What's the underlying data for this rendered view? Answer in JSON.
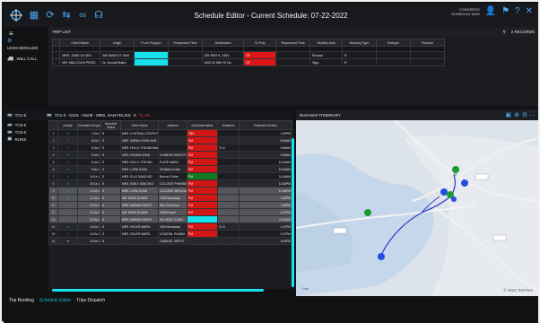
{
  "app": {
    "title": "Schedule Editor - Current Schedule: 07-22-2022",
    "user_line1": "CONGRESS",
    "user_line2": "SCHEDULE ADM"
  },
  "topbar_icons": [
    "grid-icon",
    "refresh-icon",
    "swap-icon",
    "link-icon",
    "headset-icon"
  ],
  "topbar_right_icons": [
    "user-icon",
    "filter-icon",
    "help-icon",
    "menu-icon"
  ],
  "sidebar": {
    "unscheduled_label": "UNSCHEDULED",
    "will_call_label": "WILL CALL"
  },
  "trip_list": {
    "header_label": "TRIP LIST",
    "records_label": "2 RECORDS",
    "columns": [
      "Client Name",
      "Origin",
      "From Polygon",
      "Requested Time",
      "Destination",
      "To Poly",
      "Requested Time",
      "Mobility Aids",
      "Booking Type",
      "Subtype",
      "Purpose"
    ],
    "rows": [
      {
        "client": "MRS. JANE OLSEN",
        "origin": "360 MAIN ST SAN",
        "from_poly": "",
        "req_time": "",
        "dest": "DR SMITH, 1555",
        "to_poly": "SF",
        "req_time2": "",
        "mobility": "Browse",
        "booking": "R",
        "subtype": "",
        "purpose": ""
      },
      {
        "client": "MR. MALCOLM PRICE",
        "origin": "Dr. Donald Baird",
        "from_poly": "",
        "req_time": "",
        "dest": "6302 B 28th St Oa",
        "to_poly": "SF",
        "req_time2": "",
        "mobility": "Sign",
        "booking": "R",
        "subtype": "",
        "purpose": ""
      }
    ]
  },
  "midbar": {
    "run_label": "TC1-5",
    "run_detail": "TC1-5 - D101 - M108 - MRS. SAN FELIKS",
    "marker": "X",
    "time_red": "TL-33"
  },
  "runs_sidebar": [
    {
      "label": "TC5-5",
      "icon": "bus-icon"
    },
    {
      "label": "TC5-5",
      "icon": "bus-icon"
    },
    {
      "label": "RUNS",
      "icon": "runs-icon"
    }
  ],
  "schedule": {
    "columns": [
      "",
      "Activity",
      "Estimated Depar",
      "Schedule Status",
      "Client Name",
      "Address",
      "Early/Alternative",
      "Violations",
      "Estimated Deliver"
    ],
    "rows": [
      {
        "n": "1",
        "act": "g",
        "dep": "7:0x:1",
        "status": "S",
        "client": "MRS. CYNTHIA LOCATE PHARMACY",
        "addr": "",
        "flag": "red",
        "fl": "TBD",
        "viol": "",
        "deliv": "1:25PM"
      },
      {
        "n": "2",
        "act": "b",
        "dep": "8:2x:1",
        "status": "S",
        "client": "MRS. SARAH JOHN 2631 Vicente Ave",
        "addr": "",
        "flag": "red",
        "fl": "PM",
        "viol": "",
        "deliv": "8:46AM"
      },
      {
        "n": "3",
        "act": "b",
        "dep": "8:3x:1",
        "status": "S",
        "client": "MRS. HOLLY O'DONN Main St",
        "addr": "",
        "flag": "red",
        "fl": "PM",
        "viol": "TL:4",
        "deliv": "9:46AM"
      },
      {
        "n": "4",
        "act": "g",
        "dep": "9:0x:1",
        "status": "S",
        "client": "MRS. DONNA CHAN",
        "addr": "CHINESE ANCESTOR",
        "flag": "red",
        "fl": "PM",
        "viol": "",
        "deliv": "9:46AM"
      },
      {
        "n": "5",
        "act": "b",
        "dep": "9:4x:1",
        "status": "S",
        "client": "MRS. HOLLY O'DONN",
        "addr": "PLATE WASH",
        "flag": "red",
        "fl": "PM",
        "viol": "",
        "deliv": "10:46AM"
      },
      {
        "n": "6",
        "act": "g",
        "dep": "9:5x:1",
        "status": "S",
        "client": "MRS. LORA SOSA",
        "addr": "35 Belmont Ave",
        "flag": "red",
        "fl": "PM",
        "viol": "",
        "deliv": "10:46AM"
      },
      {
        "n": "7",
        "act": "b",
        "dep": "10:1x:1",
        "status": "S",
        "client": "MRS. ELLE SANCHEZ",
        "addr": "Buena Ct Noe",
        "flag": "green",
        "fl": "PM",
        "viol": "",
        "deliv": "11:46AM"
      },
      {
        "n": "8",
        "act": "g",
        "dep": "10:1x:1",
        "status": "S",
        "client": "MRS. EMILY SANCHEZ",
        "addr": "COLLEGE PHARMA",
        "flag": "red",
        "fl": "PM",
        "viol": "",
        "deliv": "12:46PM"
      },
      {
        "n": "9",
        "act": "b",
        "dep": "11:0x:1",
        "status": "S",
        "client": "MRS. LORA SOSA",
        "addr": "COLLEGE MEDICAL",
        "flag": "red",
        "fl": "PM",
        "viol": "",
        "deliv": "12:46PM"
      },
      {
        "n": "10",
        "act": "g",
        "dep": "11:2x:1",
        "status": "S",
        "client": "MR. BRAD DUNNE",
        "addr": "1200 Broadway",
        "flag": "red",
        "fl": "PM",
        "viol": "",
        "deliv": "1:46PM"
      },
      {
        "n": "11",
        "act": "b",
        "dep": "12:0x:1",
        "status": "S",
        "client": "MRS. MARIAH SMITH",
        "addr": "661 Grand Ave",
        "flag": "red",
        "fl": "PM",
        "viol": "",
        "deliv": "1:46PM"
      },
      {
        "n": "12",
        "act": "b",
        "dep": "12:3x:1",
        "status": "S",
        "client": "MR. BRAD DUNNE",
        "addr": "1105 Powell",
        "flag": "red",
        "fl": "PM",
        "viol": "",
        "deliv": "1:47PM"
      },
      {
        "n": "13",
        "act": "b",
        "dep": "12:5x:1",
        "status": "S",
        "client": "MRS. MARIAH SMITH",
        "addr": "HILLSIDE CLINIC",
        "flag": "cyan",
        "fl": "",
        "viol": "",
        "deliv": "11:33AM"
      },
      {
        "n": "14",
        "act": "g",
        "dep": "13:0x:1",
        "status": "S",
        "client": "MRS. HELER MAPEL",
        "addr": "2000 Broadway",
        "flag": "red",
        "fl": "PM",
        "viol": "TL:3",
        "deliv": "1:47PM"
      },
      {
        "n": "15",
        "act": "b",
        "dep": "14:0x:1",
        "status": "S",
        "client": "MRS. HELER MAPEL",
        "addr": "COASTAL PHARM",
        "flag": "red",
        "fl": "PM",
        "viol": "",
        "deliv": "2:47PM"
      },
      {
        "n": "16",
        "act": "w",
        "dep": "14:0x:1",
        "status": "S",
        "client": "",
        "addr": "GARAGE, DEPOT",
        "flag": "",
        "fl": "",
        "viol": "",
        "deliv": "3:02PM"
      }
    ]
  },
  "map": {
    "header_label": "RUN MAP ITINERARY",
    "copyright": "© 2022 TomTom",
    "scale_label": "1 mi",
    "places": [
      "Oakland",
      "Alameda",
      "Berkeley",
      "San Leandro"
    ]
  },
  "tabs": [
    "Trip Booking",
    "Schedule Editor",
    "Trips Dispatch"
  ],
  "colors": {
    "accent": "#4aa6f0",
    "cyan": "#17e1ef",
    "red": "#e0151a",
    "green": "#137a1f"
  }
}
